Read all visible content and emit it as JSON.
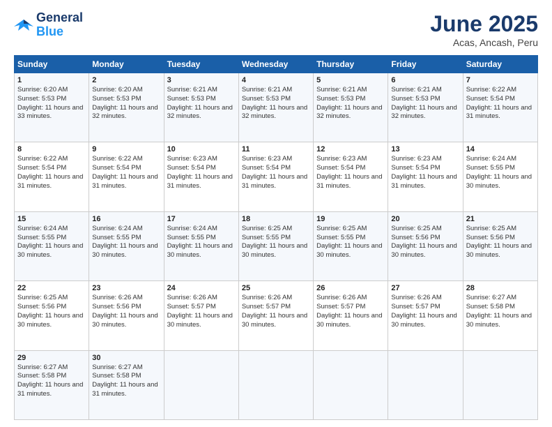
{
  "logo": {
    "line1": "General",
    "line2": "Blue"
  },
  "title": "June 2025",
  "subtitle": "Acas, Ancash, Peru",
  "days_header": [
    "Sunday",
    "Monday",
    "Tuesday",
    "Wednesday",
    "Thursday",
    "Friday",
    "Saturday"
  ],
  "weeks": [
    [
      {
        "day": "1",
        "sunrise": "6:20 AM",
        "sunset": "5:53 PM",
        "daylight": "11 hours and 33 minutes."
      },
      {
        "day": "2",
        "sunrise": "6:20 AM",
        "sunset": "5:53 PM",
        "daylight": "11 hours and 32 minutes."
      },
      {
        "day": "3",
        "sunrise": "6:21 AM",
        "sunset": "5:53 PM",
        "daylight": "11 hours and 32 minutes."
      },
      {
        "day": "4",
        "sunrise": "6:21 AM",
        "sunset": "5:53 PM",
        "daylight": "11 hours and 32 minutes."
      },
      {
        "day": "5",
        "sunrise": "6:21 AM",
        "sunset": "5:53 PM",
        "daylight": "11 hours and 32 minutes."
      },
      {
        "day": "6",
        "sunrise": "6:21 AM",
        "sunset": "5:53 PM",
        "daylight": "11 hours and 32 minutes."
      },
      {
        "day": "7",
        "sunrise": "6:22 AM",
        "sunset": "5:54 PM",
        "daylight": "11 hours and 31 minutes."
      }
    ],
    [
      {
        "day": "8",
        "sunrise": "6:22 AM",
        "sunset": "5:54 PM",
        "daylight": "11 hours and 31 minutes."
      },
      {
        "day": "9",
        "sunrise": "6:22 AM",
        "sunset": "5:54 PM",
        "daylight": "11 hours and 31 minutes."
      },
      {
        "day": "10",
        "sunrise": "6:23 AM",
        "sunset": "5:54 PM",
        "daylight": "11 hours and 31 minutes."
      },
      {
        "day": "11",
        "sunrise": "6:23 AM",
        "sunset": "5:54 PM",
        "daylight": "11 hours and 31 minutes."
      },
      {
        "day": "12",
        "sunrise": "6:23 AM",
        "sunset": "5:54 PM",
        "daylight": "11 hours and 31 minutes."
      },
      {
        "day": "13",
        "sunrise": "6:23 AM",
        "sunset": "5:54 PM",
        "daylight": "11 hours and 31 minutes."
      },
      {
        "day": "14",
        "sunrise": "6:24 AM",
        "sunset": "5:55 PM",
        "daylight": "11 hours and 30 minutes."
      }
    ],
    [
      {
        "day": "15",
        "sunrise": "6:24 AM",
        "sunset": "5:55 PM",
        "daylight": "11 hours and 30 minutes."
      },
      {
        "day": "16",
        "sunrise": "6:24 AM",
        "sunset": "5:55 PM",
        "daylight": "11 hours and 30 minutes."
      },
      {
        "day": "17",
        "sunrise": "6:24 AM",
        "sunset": "5:55 PM",
        "daylight": "11 hours and 30 minutes."
      },
      {
        "day": "18",
        "sunrise": "6:25 AM",
        "sunset": "5:55 PM",
        "daylight": "11 hours and 30 minutes."
      },
      {
        "day": "19",
        "sunrise": "6:25 AM",
        "sunset": "5:55 PM",
        "daylight": "11 hours and 30 minutes."
      },
      {
        "day": "20",
        "sunrise": "6:25 AM",
        "sunset": "5:56 PM",
        "daylight": "11 hours and 30 minutes."
      },
      {
        "day": "21",
        "sunrise": "6:25 AM",
        "sunset": "5:56 PM",
        "daylight": "11 hours and 30 minutes."
      }
    ],
    [
      {
        "day": "22",
        "sunrise": "6:25 AM",
        "sunset": "5:56 PM",
        "daylight": "11 hours and 30 minutes."
      },
      {
        "day": "23",
        "sunrise": "6:26 AM",
        "sunset": "5:56 PM",
        "daylight": "11 hours and 30 minutes."
      },
      {
        "day": "24",
        "sunrise": "6:26 AM",
        "sunset": "5:57 PM",
        "daylight": "11 hours and 30 minutes."
      },
      {
        "day": "25",
        "sunrise": "6:26 AM",
        "sunset": "5:57 PM",
        "daylight": "11 hours and 30 minutes."
      },
      {
        "day": "26",
        "sunrise": "6:26 AM",
        "sunset": "5:57 PM",
        "daylight": "11 hours and 30 minutes."
      },
      {
        "day": "27",
        "sunrise": "6:26 AM",
        "sunset": "5:57 PM",
        "daylight": "11 hours and 30 minutes."
      },
      {
        "day": "28",
        "sunrise": "6:27 AM",
        "sunset": "5:58 PM",
        "daylight": "11 hours and 30 minutes."
      }
    ],
    [
      {
        "day": "29",
        "sunrise": "6:27 AM",
        "sunset": "5:58 PM",
        "daylight": "11 hours and 31 minutes."
      },
      {
        "day": "30",
        "sunrise": "6:27 AM",
        "sunset": "5:58 PM",
        "daylight": "11 hours and 31 minutes."
      },
      null,
      null,
      null,
      null,
      null
    ]
  ]
}
